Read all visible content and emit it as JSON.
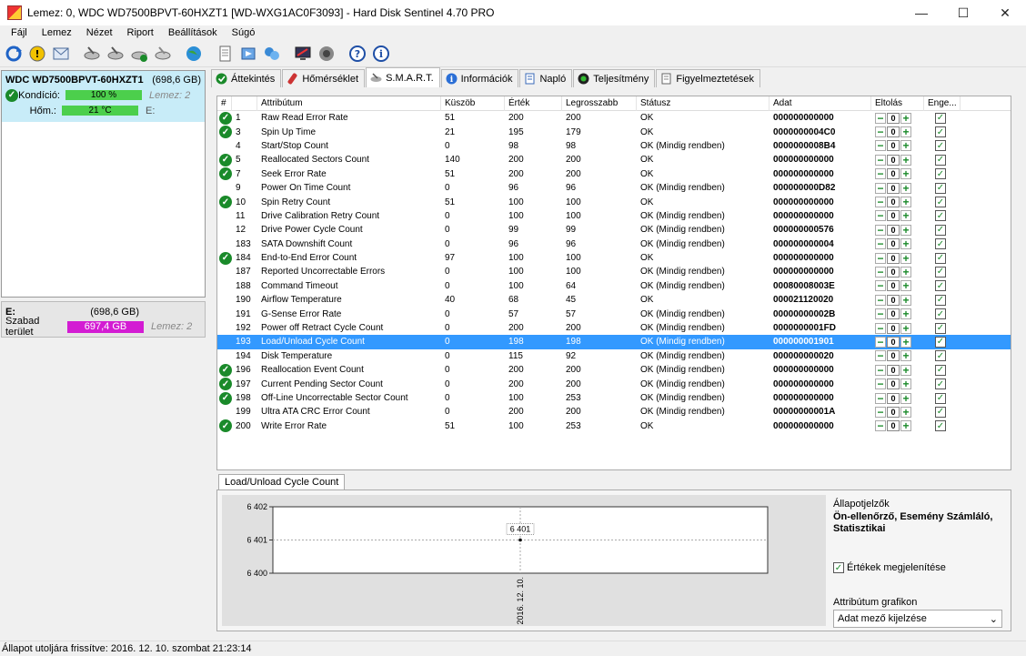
{
  "window": {
    "title": "Lemez: 0, WDC WD7500BPVT-60HXZT1 [WD-WXG1AC0F3093]  -  Hard Disk Sentinel 4.70 PRO"
  },
  "menu": [
    "Fájl",
    "Lemez",
    "Nézet",
    "Riport",
    "Beállítások",
    "Súgó"
  ],
  "disk": {
    "name": "WDC WD7500BPVT-60HXZT1",
    "size": "(698,6 GB)",
    "health_label": "Kondíció:",
    "health_value": "100 %",
    "health_meta": "Lemez: 2",
    "temp_label": "Hőm.:",
    "temp_value": "21 °C",
    "temp_meta": "E:"
  },
  "volume": {
    "letter": "E:",
    "size": "(698,6 GB)",
    "free_label": "Szabad terület",
    "free_value": "697,4 GB",
    "meta": "Lemez: 2"
  },
  "tabs": [
    "Áttekintés",
    "Hőmérséklet",
    "S.M.A.R.T.",
    "Információk",
    "Napló",
    "Teljesítmény",
    "Figyelmeztetések"
  ],
  "smart": {
    "columns": [
      "#",
      "Attribútum",
      "Küszöb",
      "Érték",
      "Legrosszabb",
      "Státusz",
      "Adat",
      "Eltolás",
      "Enge..."
    ],
    "rows": [
      {
        "ok": true,
        "id": "1",
        "name": "Raw Read Error Rate",
        "thr": "51",
        "val": "200",
        "worst": "200",
        "status": "OK",
        "data": "000000000000"
      },
      {
        "ok": true,
        "id": "3",
        "name": "Spin Up Time",
        "thr": "21",
        "val": "195",
        "worst": "179",
        "status": "OK",
        "data": "0000000004C0"
      },
      {
        "ok": false,
        "id": "4",
        "name": "Start/Stop Count",
        "thr": "0",
        "val": "98",
        "worst": "98",
        "status": "OK (Mindig rendben)",
        "data": "0000000008B4"
      },
      {
        "ok": true,
        "id": "5",
        "name": "Reallocated Sectors Count",
        "thr": "140",
        "val": "200",
        "worst": "200",
        "status": "OK",
        "data": "000000000000"
      },
      {
        "ok": true,
        "id": "7",
        "name": "Seek Error Rate",
        "thr": "51",
        "val": "200",
        "worst": "200",
        "status": "OK",
        "data": "000000000000"
      },
      {
        "ok": false,
        "id": "9",
        "name": "Power On Time Count",
        "thr": "0",
        "val": "96",
        "worst": "96",
        "status": "OK (Mindig rendben)",
        "data": "000000000D82"
      },
      {
        "ok": true,
        "id": "10",
        "name": "Spin Retry Count",
        "thr": "51",
        "val": "100",
        "worst": "100",
        "status": "OK",
        "data": "000000000000"
      },
      {
        "ok": false,
        "id": "11",
        "name": "Drive Calibration Retry Count",
        "thr": "0",
        "val": "100",
        "worst": "100",
        "status": "OK (Mindig rendben)",
        "data": "000000000000"
      },
      {
        "ok": false,
        "id": "12",
        "name": "Drive Power Cycle Count",
        "thr": "0",
        "val": "99",
        "worst": "99",
        "status": "OK (Mindig rendben)",
        "data": "000000000576"
      },
      {
        "ok": false,
        "id": "183",
        "name": "SATA Downshift Count",
        "thr": "0",
        "val": "96",
        "worst": "96",
        "status": "OK (Mindig rendben)",
        "data": "000000000004"
      },
      {
        "ok": true,
        "id": "184",
        "name": "End-to-End Error Count",
        "thr": "97",
        "val": "100",
        "worst": "100",
        "status": "OK",
        "data": "000000000000"
      },
      {
        "ok": false,
        "id": "187",
        "name": "Reported Uncorrectable Errors",
        "thr": "0",
        "val": "100",
        "worst": "100",
        "status": "OK (Mindig rendben)",
        "data": "000000000000"
      },
      {
        "ok": false,
        "id": "188",
        "name": "Command Timeout",
        "thr": "0",
        "val": "100",
        "worst": "64",
        "status": "OK (Mindig rendben)",
        "data": "00080008003E"
      },
      {
        "ok": false,
        "id": "190",
        "name": "Airflow Temperature",
        "thr": "40",
        "val": "68",
        "worst": "45",
        "status": "OK",
        "data": "000021120020"
      },
      {
        "ok": false,
        "id": "191",
        "name": "G-Sense Error Rate",
        "thr": "0",
        "val": "57",
        "worst": "57",
        "status": "OK (Mindig rendben)",
        "data": "00000000002B"
      },
      {
        "ok": false,
        "id": "192",
        "name": "Power off Retract Cycle Count",
        "thr": "0",
        "val": "200",
        "worst": "200",
        "status": "OK (Mindig rendben)",
        "data": "0000000001FD"
      },
      {
        "ok": false,
        "id": "193",
        "name": "Load/Unload Cycle Count",
        "thr": "0",
        "val": "198",
        "worst": "198",
        "status": "OK (Mindig rendben)",
        "data": "000000001901",
        "selected": true
      },
      {
        "ok": false,
        "id": "194",
        "name": "Disk Temperature",
        "thr": "0",
        "val": "115",
        "worst": "92",
        "status": "OK (Mindig rendben)",
        "data": "000000000020"
      },
      {
        "ok": true,
        "id": "196",
        "name": "Reallocation Event Count",
        "thr": "0",
        "val": "200",
        "worst": "200",
        "status": "OK (Mindig rendben)",
        "data": "000000000000"
      },
      {
        "ok": true,
        "id": "197",
        "name": "Current Pending Sector Count",
        "thr": "0",
        "val": "200",
        "worst": "200",
        "status": "OK (Mindig rendben)",
        "data": "000000000000"
      },
      {
        "ok": true,
        "id": "198",
        "name": "Off-Line Uncorrectable Sector Count",
        "thr": "0",
        "val": "100",
        "worst": "253",
        "status": "OK (Mindig rendben)",
        "data": "000000000000"
      },
      {
        "ok": false,
        "id": "199",
        "name": "Ultra ATA CRC Error Count",
        "thr": "0",
        "val": "200",
        "worst": "200",
        "status": "OK (Mindig rendben)",
        "data": "00000000001A"
      },
      {
        "ok": true,
        "id": "200",
        "name": "Write Error Rate",
        "thr": "51",
        "val": "100",
        "worst": "253",
        "status": "OK",
        "data": "000000000000"
      }
    ],
    "offset_value": "0"
  },
  "chart_tab": "Load/Unload Cycle Count",
  "chart_data": {
    "type": "line",
    "x": [
      "2016. 12. 10."
    ],
    "values": [
      6401
    ],
    "ylim": [
      6400,
      6402
    ],
    "yticks": [
      "6 402",
      "6 401",
      "6 400"
    ],
    "point_label": "6 401",
    "grid": true
  },
  "right_panel": {
    "heading": "Állapotjelzők",
    "desc": "Ön-ellenőrző, Esemény Számláló, Statisztikai",
    "show_values_label": "Értékek megjelenítése",
    "graph_label": "Attribútum grafikon",
    "graph_select": "Adat mező kijelzése"
  },
  "status": "Állapot utoljára frissítve: 2016. 12. 10. szombat 21:23:14"
}
